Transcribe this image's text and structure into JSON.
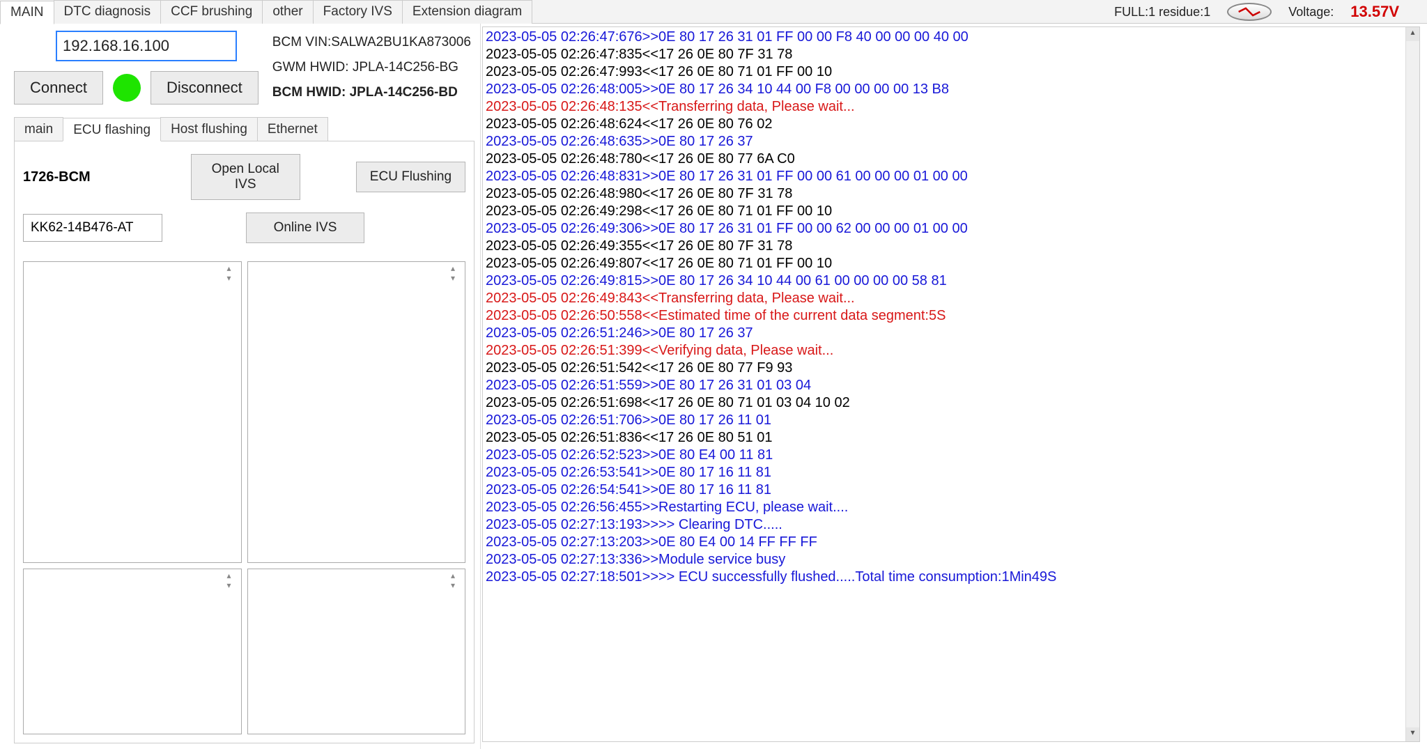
{
  "topTabs": [
    "MAIN",
    "DTC diagnosis",
    "CCF brushing",
    "other",
    "Factory IVS",
    "Extension diagram"
  ],
  "topActiveIndex": 0,
  "status": {
    "full_text": "FULL:1 residue:1",
    "voltage_label": "Voltage:",
    "voltage_value": "13.57V"
  },
  "connection": {
    "ip_value": "192.168.16.100",
    "connect_label": "Connect",
    "disconnect_label": "Disconnect",
    "status_color": "#1ee400"
  },
  "info": {
    "bcm_vin": "BCM VIN:SALWA2BU1KA873006",
    "gwm_hwid": "GWM HWID: JPLA-14C256-BG",
    "bcm_hwid": "BCM HWID: JPLA-14C256-BD"
  },
  "subTabs": [
    "main",
    "ECU flashing",
    "Host flushing",
    "Ethernet"
  ],
  "subActiveIndex": 1,
  "ecu": {
    "module_label": "1726-BCM",
    "open_local_ivs": "Open Local IVS",
    "ecu_flushing": "ECU Flushing",
    "online_ivs": "Online IVS",
    "part_input_value": "KK62-14B476-AT"
  },
  "log": [
    {
      "c": "blue",
      "t": "2023-05-05 02:26:47:676>>0E 80 17 26 31 01 FF 00 00 F8 40 00 00 00 40 00"
    },
    {
      "c": "black",
      "t": "2023-05-05 02:26:47:835<<17 26 0E 80 7F 31 78"
    },
    {
      "c": "black",
      "t": "2023-05-05 02:26:47:993<<17 26 0E 80 71 01 FF 00 10"
    },
    {
      "c": "blue",
      "t": "2023-05-05 02:26:48:005>>0E 80 17 26 34 10 44 00 F8 00 00 00 00 13 B8"
    },
    {
      "c": "red",
      "t": "2023-05-05 02:26:48:135<<Transferring data, Please wait..."
    },
    {
      "c": "black",
      "t": "2023-05-05 02:26:48:624<<17 26 0E 80 76 02"
    },
    {
      "c": "blue",
      "t": "2023-05-05 02:26:48:635>>0E 80 17 26 37"
    },
    {
      "c": "black",
      "t": "2023-05-05 02:26:48:780<<17 26 0E 80 77 6A C0"
    },
    {
      "c": "blue",
      "t": "2023-05-05 02:26:48:831>>0E 80 17 26 31 01 FF 00 00 61 00 00 00 01 00 00"
    },
    {
      "c": "black",
      "t": "2023-05-05 02:26:48:980<<17 26 0E 80 7F 31 78"
    },
    {
      "c": "black",
      "t": "2023-05-05 02:26:49:298<<17 26 0E 80 71 01 FF 00 10"
    },
    {
      "c": "blue",
      "t": "2023-05-05 02:26:49:306>>0E 80 17 26 31 01 FF 00 00 62 00 00 00 01 00 00"
    },
    {
      "c": "black",
      "t": "2023-05-05 02:26:49:355<<17 26 0E 80 7F 31 78"
    },
    {
      "c": "black",
      "t": "2023-05-05 02:26:49:807<<17 26 0E 80 71 01 FF 00 10"
    },
    {
      "c": "blue",
      "t": "2023-05-05 02:26:49:815>>0E 80 17 26 34 10 44 00 61 00 00 00 00 58 81"
    },
    {
      "c": "red",
      "t": "2023-05-05 02:26:49:843<<Transferring data, Please wait..."
    },
    {
      "c": "red",
      "t": "2023-05-05 02:26:50:558<<Estimated time of the current data segment:5S"
    },
    {
      "c": "blue",
      "t": "2023-05-05 02:26:51:246>>0E 80 17 26 37"
    },
    {
      "c": "red",
      "t": "2023-05-05 02:26:51:399<<Verifying data, Please wait..."
    },
    {
      "c": "black",
      "t": "2023-05-05 02:26:51:542<<17 26 0E 80 77 F9 93"
    },
    {
      "c": "blue",
      "t": "2023-05-05 02:26:51:559>>0E 80 17 26 31 01 03 04"
    },
    {
      "c": "black",
      "t": "2023-05-05 02:26:51:698<<17 26 0E 80 71 01 03 04 10 02"
    },
    {
      "c": "blue",
      "t": "2023-05-05 02:26:51:706>>0E 80 17 26 11 01"
    },
    {
      "c": "black",
      "t": "2023-05-05 02:26:51:836<<17 26 0E 80 51 01"
    },
    {
      "c": "blue",
      "t": "2023-05-05 02:26:52:523>>0E 80 E4 00 11 81"
    },
    {
      "c": "blue",
      "t": "2023-05-05 02:26:53:541>>0E 80 17 16 11 81"
    },
    {
      "c": "blue",
      "t": "2023-05-05 02:26:54:541>>0E 80 17 16 11 81"
    },
    {
      "c": "blue",
      "t": "2023-05-05 02:26:56:455>>Restarting ECU, please wait...."
    },
    {
      "c": "blue",
      "t": "2023-05-05 02:27:13:193>>>> Clearing DTC....."
    },
    {
      "c": "blue",
      "t": "2023-05-05 02:27:13:203>>0E 80 E4 00 14 FF FF FF"
    },
    {
      "c": "blue",
      "t": "2023-05-05 02:27:13:336>>Module service busy"
    },
    {
      "c": "blue",
      "t": "2023-05-05 02:27:18:501>>>> ECU successfully flushed.....Total time consumption:1Min49S"
    }
  ]
}
